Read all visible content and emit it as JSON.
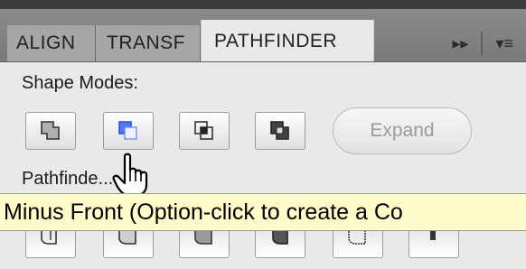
{
  "tabs": [
    {
      "label": "ALIGN",
      "active": false
    },
    {
      "label": "TRANSF",
      "active": false
    },
    {
      "label": "PATHFINDER",
      "active": true
    }
  ],
  "toolbar": {
    "collapse_glyph": "▸▸",
    "menu_glyph": "▾≡"
  },
  "sections": {
    "shape_modes_label": "Shape Modes:",
    "pathfinders_label": "Pathfinde..."
  },
  "shape_modes": {
    "icons": [
      "unite-icon",
      "minus-front-icon",
      "intersect-icon",
      "exclude-icon"
    ],
    "expand_label": "Expand",
    "selected_index": 1
  },
  "tooltip": {
    "text": "Minus Front (Option-click to create a Co"
  },
  "pathfinders": {
    "icons": [
      "divide-icon",
      "trim-icon",
      "merge-icon",
      "crop-icon",
      "outline-icon",
      "minus-back-icon"
    ]
  },
  "colors": {
    "tab_bar": "#7f7f7f",
    "panel_bg": "#e9e9e9",
    "tooltip_bg": "#fffccb",
    "accent_blue": "#2d4fd8"
  }
}
